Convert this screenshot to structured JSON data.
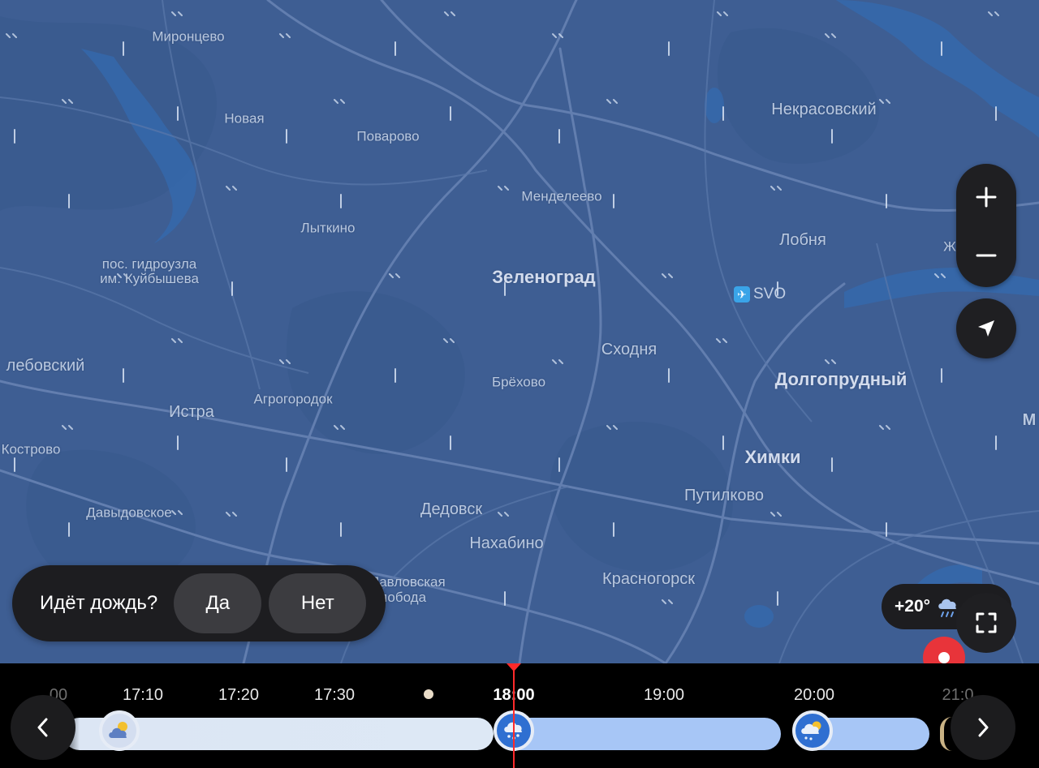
{
  "map": {
    "places": {
      "mironcevo": "Миронцево",
      "novaya": "Новая",
      "povarovo": "Поварово",
      "nekrasovsky": "Некрасовский",
      "mendeleevo": "Менделеево",
      "lobnya": "Лобня",
      "lytkino": "Лыткино",
      "gidrouzel": "пос. гидроузла им. Куйбышева",
      "zelenograd": "Зеленоград",
      "skhodnya": "Сходня",
      "lebovsky": "лебовский",
      "istra": "Истра",
      "agrogorodok": "Агрогородок",
      "brekhovo": "Брёхово",
      "dolgoprudny": "Долгопрудный",
      "kostrovo": "Кострово",
      "khimki": "Химки",
      "davydovskoe": "Давыдовское",
      "dedovsk": "Дедовск",
      "putilkovo": "Путилково",
      "nakhabino": "Нахабино",
      "pavlovskaya": "Павловская Слобода",
      "krasnogorsk": "Красногорск",
      "zh": "Ж",
      "m": "М"
    },
    "airport_code": "SVO"
  },
  "controls": {
    "zoom_in_icon": "plus-icon",
    "zoom_out_icon": "minus-icon",
    "locate_icon": "navigation-arrow-icon",
    "fullscreen_icon": "fullscreen-icon"
  },
  "rain_question": {
    "question": "Идёт дождь?",
    "yes": "Да",
    "no": "Нет"
  },
  "weather_badge": {
    "temperature": "+20°",
    "icon": "cloud-rain-icon"
  },
  "timeline": {
    "ticks": [
      {
        "label": "00"
      },
      {
        "label": "17:10"
      },
      {
        "label": "17:20"
      },
      {
        "label": "17:30"
      },
      {
        "label": "18:00"
      },
      {
        "label": "19:00"
      },
      {
        "label": "20:00"
      },
      {
        "label": "21:0"
      }
    ],
    "current": "18:00",
    "colors": {
      "needle": "#ff2a2a",
      "rain_bar": "#a7c6f6",
      "light_bar": "#dde8f5"
    }
  }
}
